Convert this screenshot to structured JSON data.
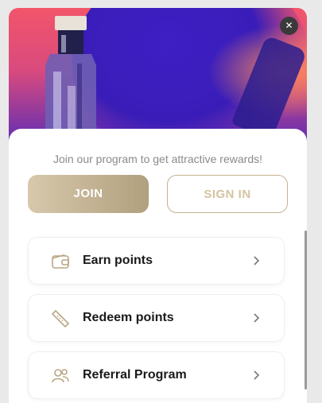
{
  "popup": {
    "close_label": "✕",
    "tagline": "Join our program to get attractive rewards!",
    "join_label": "JOIN",
    "signin_label": "SIGN IN"
  },
  "items": [
    {
      "label": "Earn points",
      "icon": "wallet-icon"
    },
    {
      "label": "Redeem points",
      "icon": "ticket-icon"
    },
    {
      "label": "Referral Program",
      "icon": "users-icon"
    }
  ],
  "colors": {
    "accent": "#b8a784",
    "signin_text": "#d4c39e",
    "icon": "#b8a784"
  }
}
